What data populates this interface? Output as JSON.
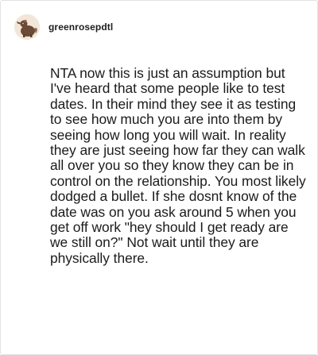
{
  "post": {
    "username": "greenrosepdtl",
    "avatar_icon": "anteater-avatar-icon",
    "comment_text": "NTA now this is just an assumption but I've heard that some people like to test dates. In their mind they see it as testing to see how much you are into them by seeing how long you will wait. In reality they are just seeing how far they can walk all over you so they know they can be in control on the relationship. You most likely dodged a bullet. If she dosnt know of the date was on you ask around 5 when you get off work \"hey should I get ready are we still on?\" Not wait until they are physically there."
  },
  "colors": {
    "avatar_background": "#f2e6d8",
    "avatar_figure": "#6b4a36",
    "text": "#1b1b1b",
    "card_border": "#e3e3e3"
  }
}
